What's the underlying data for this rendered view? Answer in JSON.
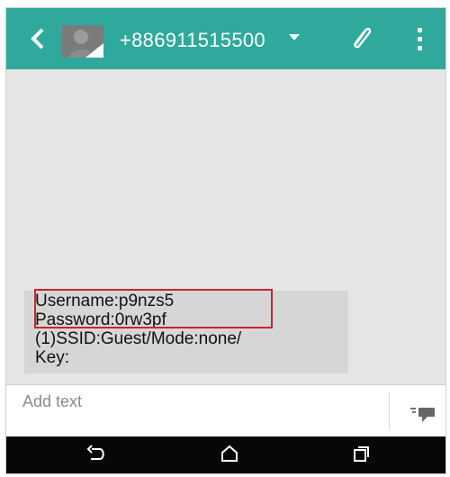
{
  "header": {
    "phone_number": "+886911515500",
    "icons": {
      "back": "back-arrow-icon",
      "avatar": "contact-avatar",
      "dropdown": "chevron-down-icon",
      "attach": "paperclip-icon",
      "more": "more-vert-icon"
    }
  },
  "message": {
    "lines": [
      "Username:p9nzs5",
      "Password:0rw3pf",
      "(1)SSID:Guest/Mode:none/",
      "Key:"
    ]
  },
  "composer": {
    "placeholder": "Add text",
    "send_icon": "send-message-icon"
  },
  "navigation": {
    "back_icon": "nav-back-icon",
    "home_icon": "nav-home-icon",
    "recents_icon": "nav-recents-icon"
  },
  "colors": {
    "appbar": "#2fa99b",
    "chat_background": "#e5e5e5",
    "bubble": "#d6d6d6",
    "highlight": "#c8262e",
    "navbar": "#070707"
  }
}
